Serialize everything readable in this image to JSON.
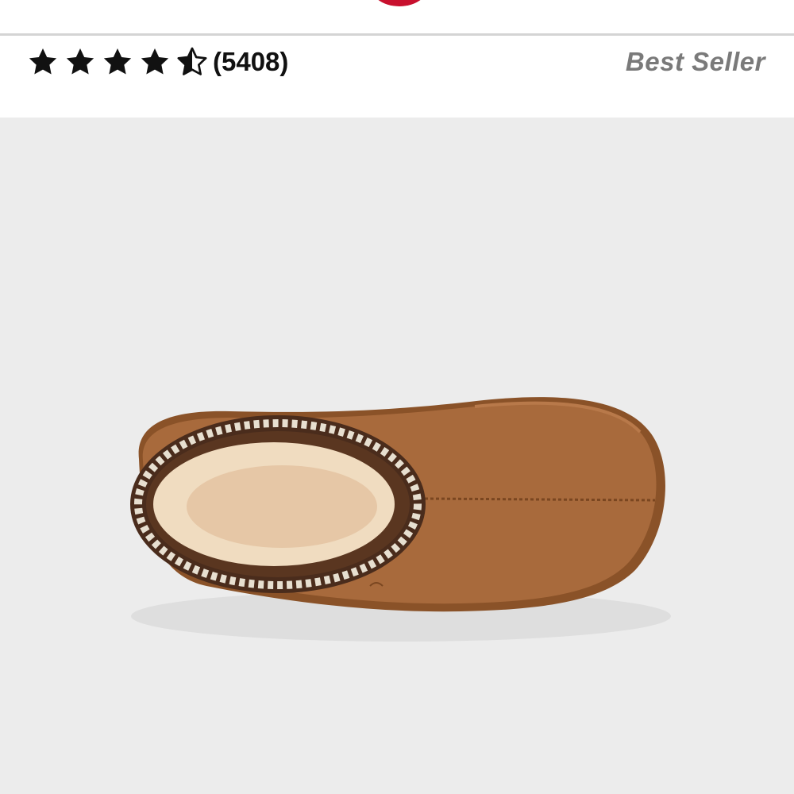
{
  "header": {
    "logo_icon": "brand-logo-icon",
    "logo_color": "#c8102e"
  },
  "rating": {
    "value": 4.5,
    "max": 5,
    "star_icon": "star-icon",
    "review_count": "(5408)",
    "star_color": "#111111"
  },
  "badge": {
    "label": "Best Seller",
    "color": "#7a7a7a"
  },
  "product_image": {
    "subject_icon": "slipper-image",
    "background": "#ececec",
    "suede_color": "#a86a3c",
    "lining_color": "#f0dcc0"
  }
}
